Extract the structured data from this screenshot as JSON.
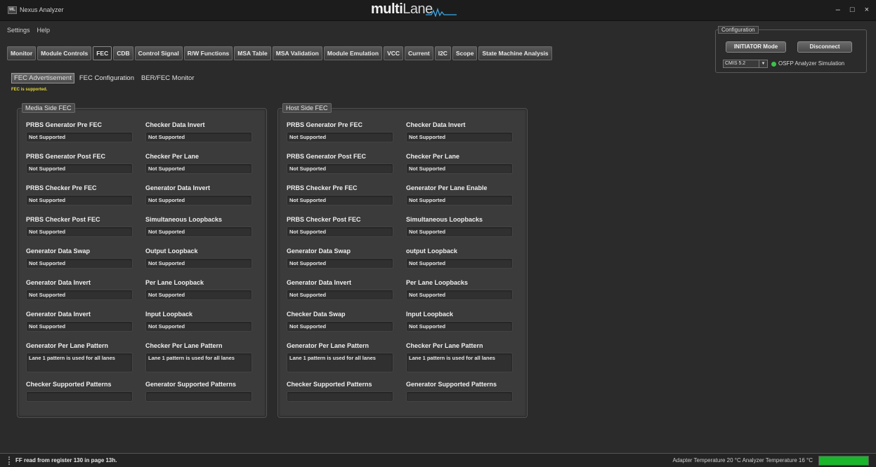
{
  "app": {
    "icon_text": "ML",
    "title": "Nexus Analyzer",
    "brand_bold": "multi",
    "brand_light": "Lane",
    "window_buttons": [
      "–",
      "□",
      "×"
    ]
  },
  "menu": [
    "Settings",
    "Help"
  ],
  "main_tabs": [
    "Monitor",
    "Module Controls",
    "FEC",
    "CDB",
    "Control Signal",
    "R/W Functions",
    "MSA Table",
    "MSA Validation",
    "Module Emulation",
    "VCC",
    "Current",
    "I2C",
    "Scope",
    "State Machine Analysis"
  ],
  "main_tab_active": "FEC",
  "sub_tabs": [
    "FEC Advertisement",
    "FEC Configuration",
    "BER/FEC Monitor"
  ],
  "sub_tab_active": "FEC Advertisement",
  "fec_status": "FEC is supported.",
  "media_panel": {
    "title": "Media Side FEC",
    "fields": [
      {
        "label": "PRBS Generator Pre FEC",
        "value": "Not Supported"
      },
      {
        "label": "Checker Data Invert",
        "value": "Not Supported"
      },
      {
        "label": "PRBS Generator Post FEC",
        "value": "Not Supported"
      },
      {
        "label": "Checker Per Lane",
        "value": "Not Supported"
      },
      {
        "label": "PRBS Checker Pre FEC",
        "value": "Not Supported"
      },
      {
        "label": "Generator Data Invert",
        "value": "Not Supported"
      },
      {
        "label": "PRBS Checker Post FEC",
        "value": "Not Supported"
      },
      {
        "label": "Simultaneous Loopbacks",
        "value": "Not Supported"
      },
      {
        "label": "Generator Data Swap",
        "value": "Not Supported"
      },
      {
        "label": "Output Loopback",
        "value": "Not Supported"
      },
      {
        "label": "Generator Data Invert",
        "value": "Not Supported"
      },
      {
        "label": "Per Lane Loopback",
        "value": "Not Supported"
      },
      {
        "label": "Generator Data Invert",
        "value": "Not Supported"
      },
      {
        "label": "Input Loopback",
        "value": "Not Supported"
      },
      {
        "label": "Generator Per Lane Pattern",
        "value": "Lane 1 pattern is used for all lanes"
      },
      {
        "label": "Checker Per Lane Pattern",
        "value": "Lane 1 pattern is used for all lanes"
      },
      {
        "label": "Checker Supported Patterns",
        "value": ""
      },
      {
        "label": "Generator Supported Patterns",
        "value": ""
      }
    ]
  },
  "host_panel": {
    "title": "Host Side FEC",
    "fields": [
      {
        "label": "PRBS Generator Pre FEC",
        "value": "Not Supported"
      },
      {
        "label": "Checker Data Invert",
        "value": "Not Supported"
      },
      {
        "label": "PRBS Generator Post FEC",
        "value": "Not Supported"
      },
      {
        "label": "Checker Per Lane",
        "value": "Not Supported"
      },
      {
        "label": "PRBS Checker Pre FEC",
        "value": "Not Supported"
      },
      {
        "label": "Generator Per Lane Enable",
        "value": "Not Supported"
      },
      {
        "label": "PRBS Checker Post FEC",
        "value": "Not Supported"
      },
      {
        "label": "Simultaneous Loopbacks",
        "value": "Not Supported"
      },
      {
        "label": "Generator Data Swap",
        "value": "Not Supported"
      },
      {
        "label": "output Loopback",
        "value": "Not Supported"
      },
      {
        "label": "Generator Data Invert",
        "value": "Not Supported"
      },
      {
        "label": "Per Lane Loopbacks",
        "value": "Not Supported"
      },
      {
        "label": "Checker Data Swap",
        "value": "Not Supported"
      },
      {
        "label": "Input Loopback",
        "value": "Not Supported"
      },
      {
        "label": "Generator Per Lane Pattern",
        "value": "Lane 1 pattern is used for all lanes"
      },
      {
        "label": "Checker Per Lane Pattern",
        "value": "Lane 1 pattern is used for all lanes"
      },
      {
        "label": "Checker Supported Patterns",
        "value": ""
      },
      {
        "label": "Generator Supported Patterns",
        "value": ""
      }
    ]
  },
  "configuration": {
    "title": "Configuration",
    "initiator_label": "INITIATOR Mode",
    "disconnect_label": "Disconnect",
    "cmis_value": "CMIS 5.2",
    "sim_label": "OSFP Analyzer Simulation",
    "sim_color": "#3bc24a"
  },
  "status": {
    "message": "FF read from register 130 in page 13h.",
    "temperature": "Adapter Temperature 20 °C  Analyzer Temperature 16 °C",
    "progress": 1.0,
    "progress_color": "#19b62b"
  }
}
